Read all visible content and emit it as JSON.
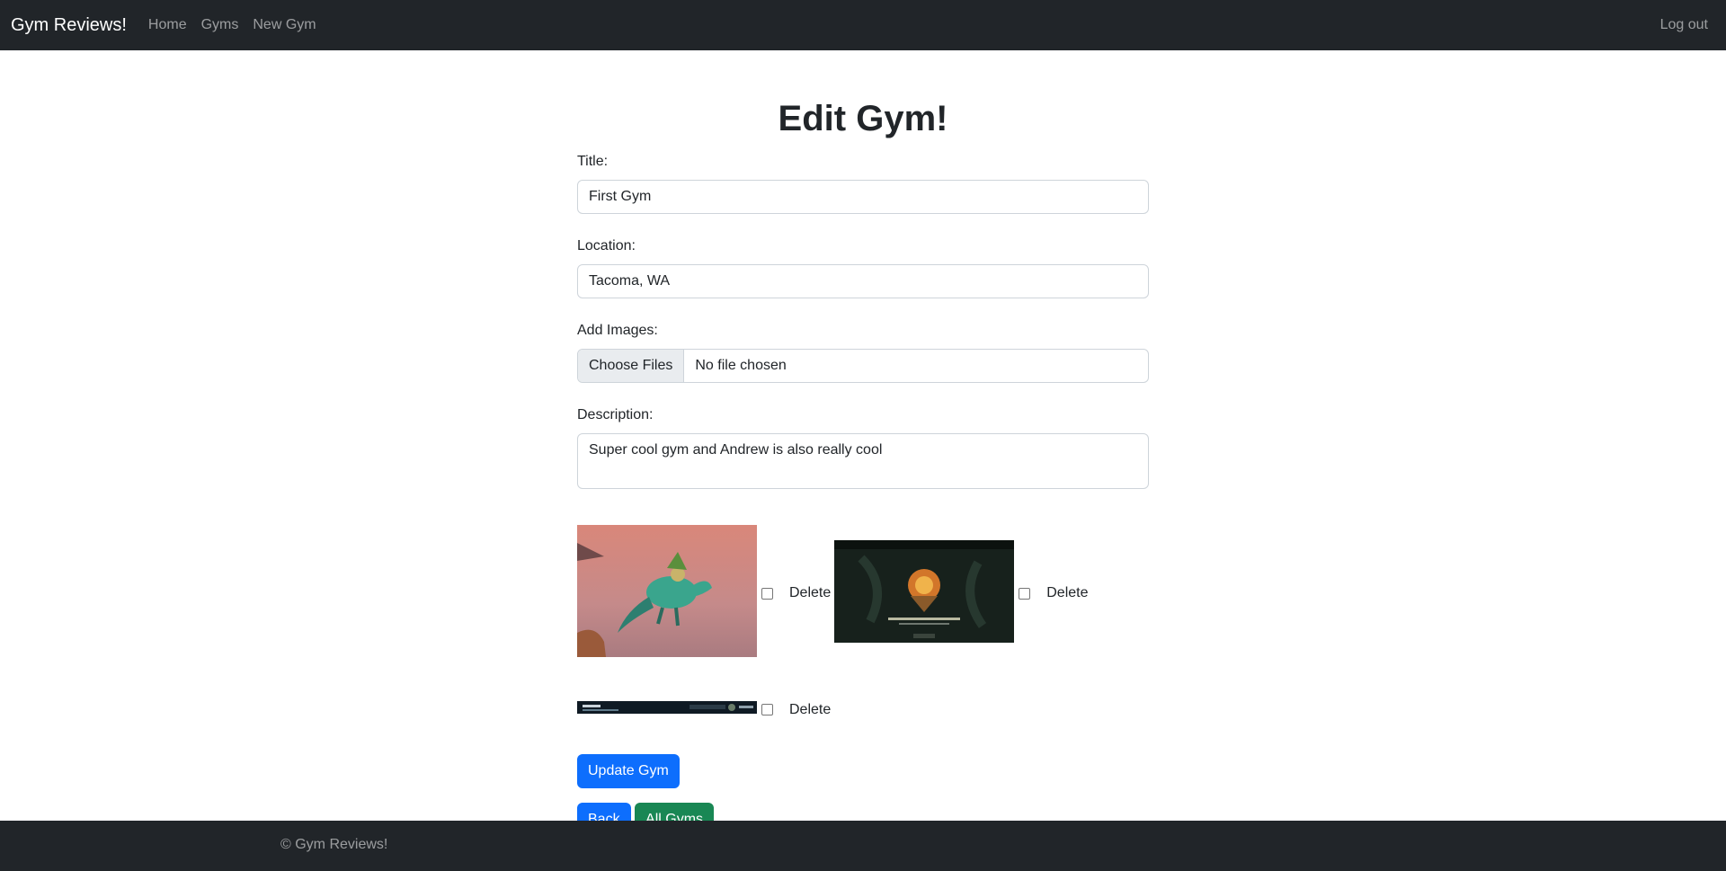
{
  "nav": {
    "brand": "Gym Reviews!",
    "links": [
      "Home",
      "Gyms",
      "New Gym"
    ],
    "logout": "Log out"
  },
  "page": {
    "title": "Edit Gym!"
  },
  "form": {
    "title_label": "Title:",
    "title_value": "First Gym",
    "location_label": "Location:",
    "location_value": "Tacoma, WA",
    "images_label": "Add Images:",
    "file_button": "Choose Files",
    "file_status": "No file chosen",
    "description_label": "Description:",
    "description_value": "Super cool gym and Andrew is also really cool"
  },
  "images": [
    {
      "delete_label": "Delete"
    },
    {
      "delete_label": "Delete"
    },
    {
      "delete_label": "Delete"
    }
  ],
  "buttons": {
    "update": "Update Gym",
    "back": "Back",
    "all_gyms": "All Gyms"
  },
  "footer": {
    "text": "© Gym Reviews!"
  },
  "colors": {
    "navbar": "#212529",
    "primary": "#0d6efd",
    "success": "#198754"
  }
}
